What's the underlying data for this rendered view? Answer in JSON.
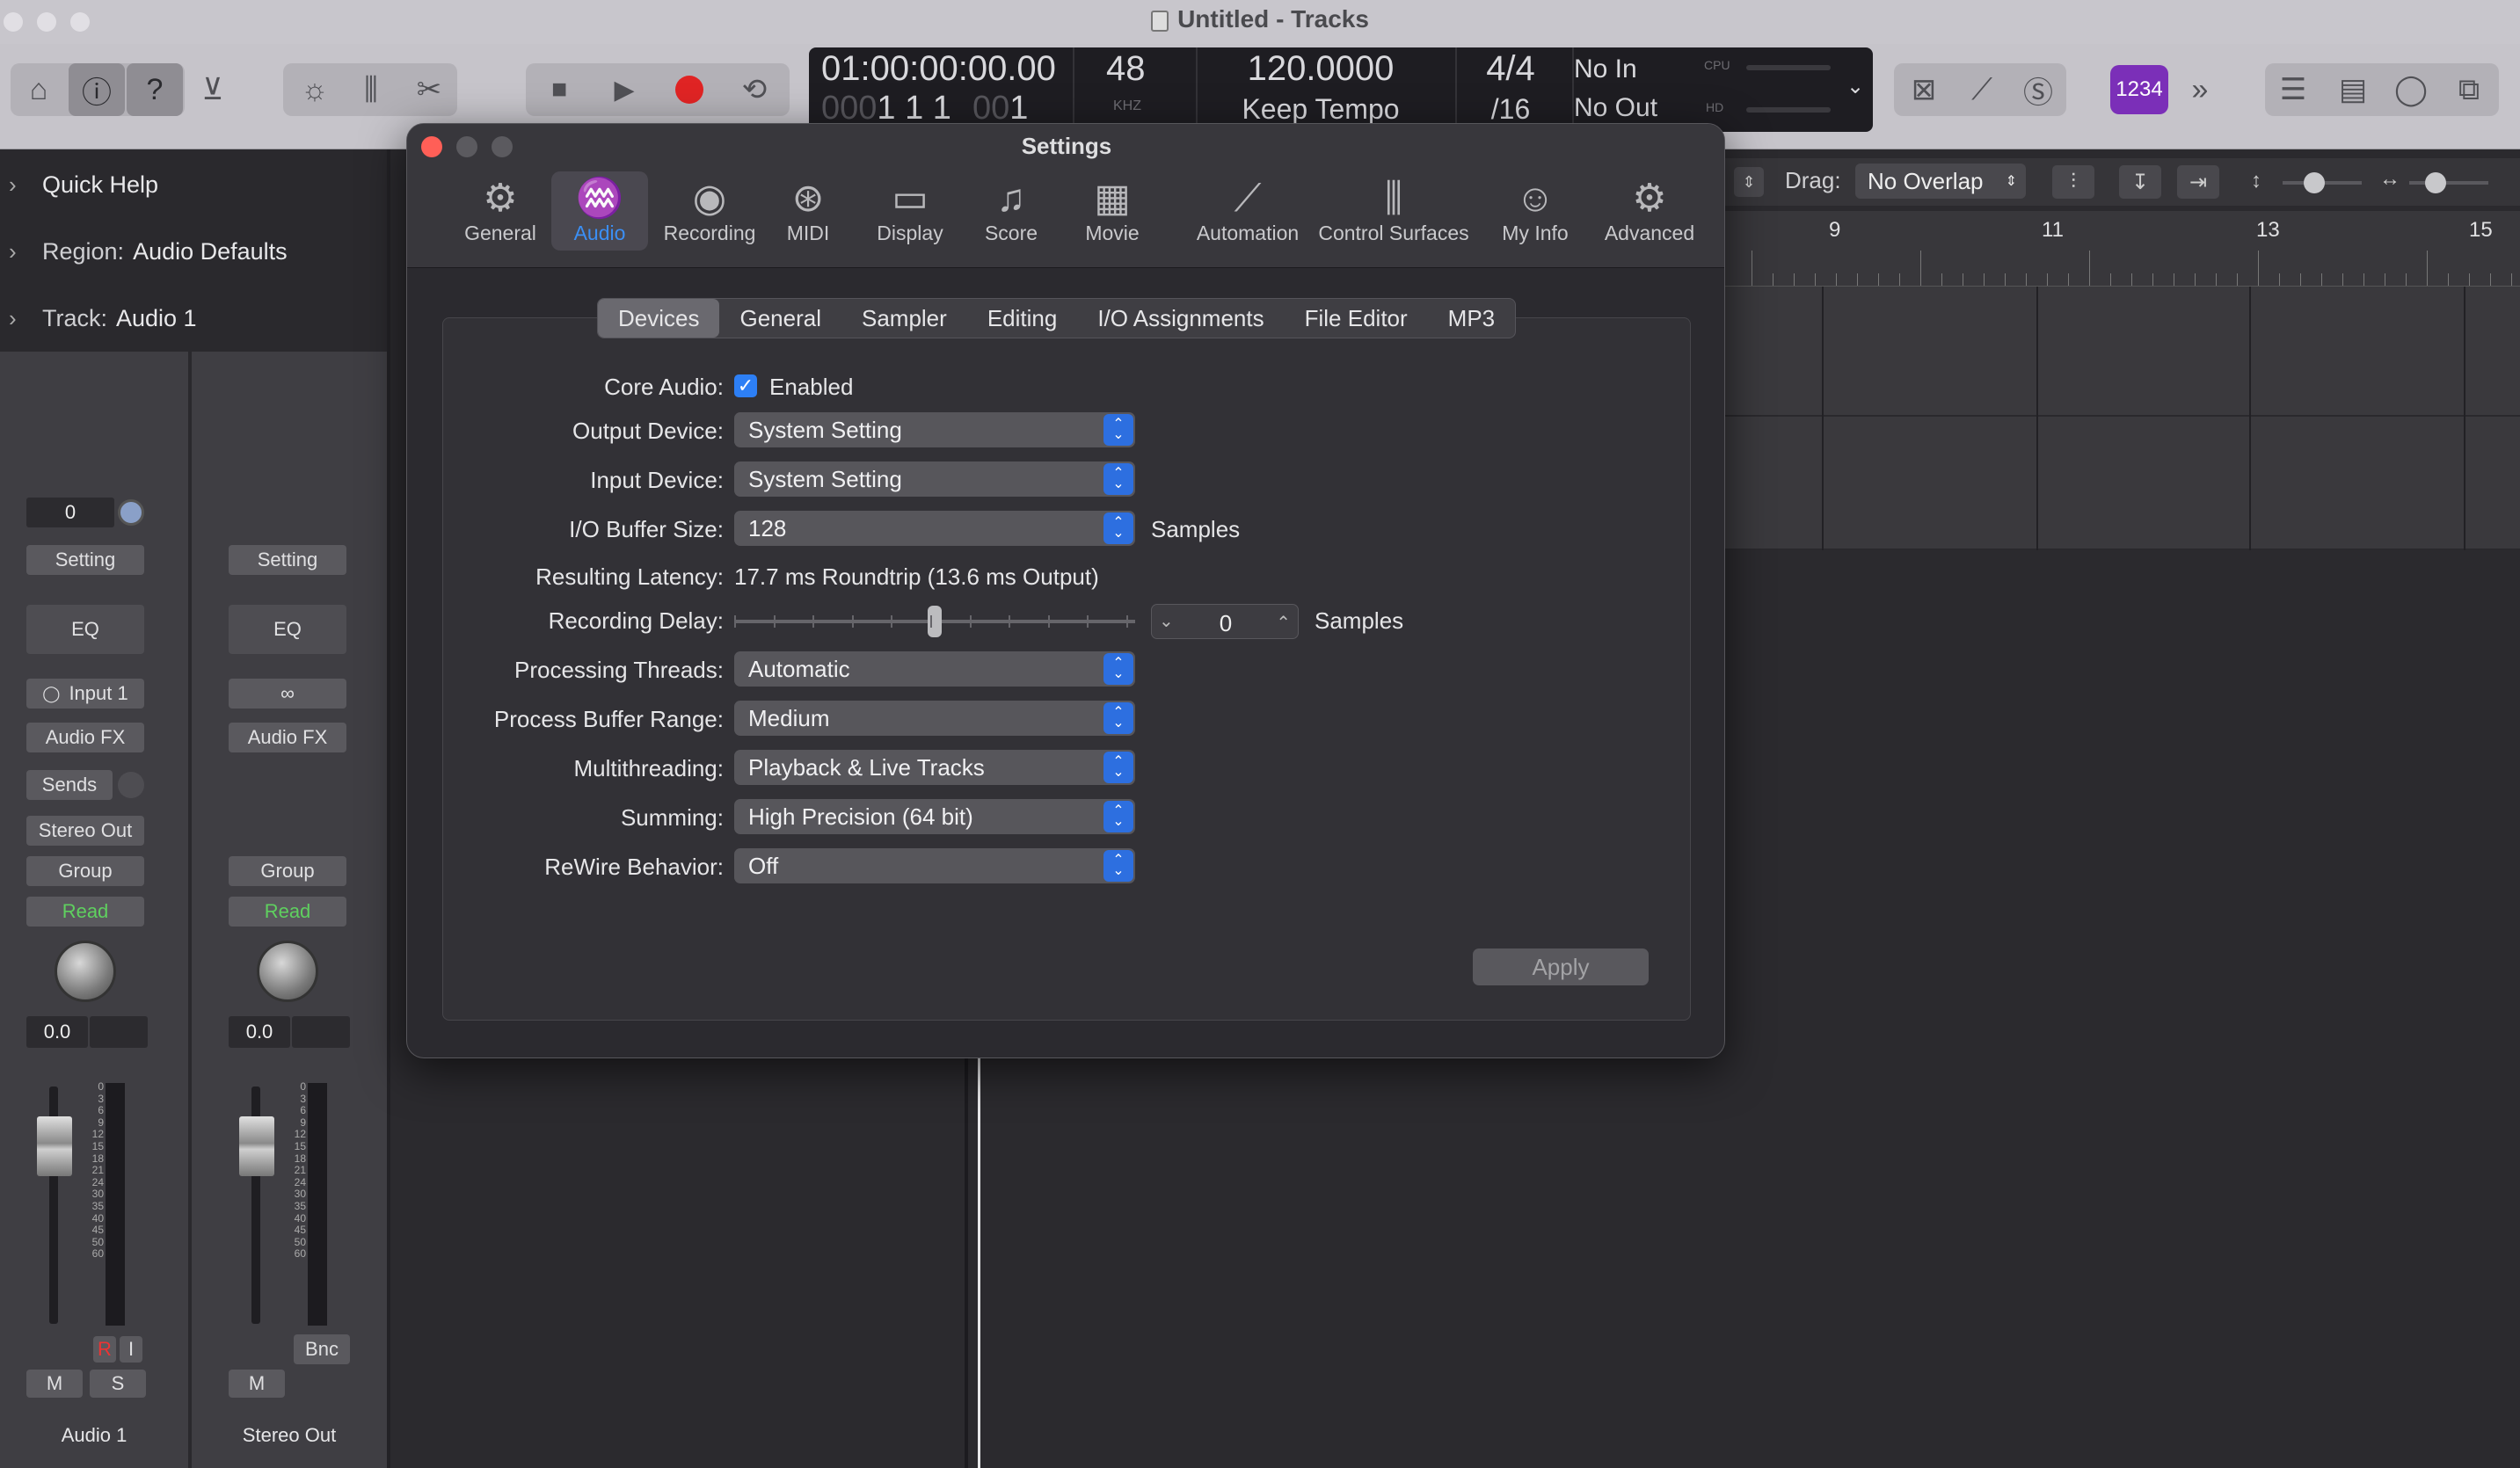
{
  "window": {
    "title": "Untitled - Tracks"
  },
  "lcd": {
    "time": "01:00:00:00.00",
    "bars_dim": "000",
    "bars": "1  1  1",
    "beat_dim": "00",
    "beat": "1",
    "samplerate": "48",
    "khz": "KHZ",
    "tempo": "120.0000",
    "tempo_mode": "Keep Tempo",
    "sig_top": "4/4",
    "sig_bottom": "/16",
    "in": "No In",
    "out": "No Out",
    "cpu": "CPU",
    "hd": "HD"
  },
  "toolbar": {
    "badge": "1234",
    "drag_label": "Drag:",
    "drag_value": "No Overlap"
  },
  "inspector": {
    "quick_help": "Quick Help",
    "region_label": "Region:",
    "region_value": "Audio Defaults",
    "track_label": "Track:",
    "track_value": "Audio 1"
  },
  "strip1": {
    "gain": "0",
    "setting": "Setting",
    "eq": "EQ",
    "input": "Input 1",
    "audiofx": "Audio FX",
    "sends": "Sends",
    "output": "Stereo Out",
    "group": "Group",
    "read": "Read",
    "vol": "0.0",
    "r": "R",
    "i": "I",
    "m": "M",
    "s": "S",
    "name": "Audio 1"
  },
  "strip2": {
    "setting": "Setting",
    "eq": "EQ",
    "audiofx": "Audio FX",
    "group": "Group",
    "read": "Read",
    "vol": "0.0",
    "bnc": "Bnc",
    "m": "M",
    "name": "Stereo Out"
  },
  "meter_scale": [
    "0",
    "3",
    "6",
    "9",
    "12",
    "15",
    "18",
    "21",
    "24",
    "30",
    "35",
    "40",
    "45",
    "50",
    "60"
  ],
  "ruler": {
    "marks": [
      "9",
      "11",
      "13",
      "15"
    ]
  },
  "settings": {
    "title": "Settings",
    "tabs": [
      "General",
      "Audio",
      "Recording",
      "MIDI",
      "Display",
      "Score",
      "Movie",
      "Automation",
      "Control Surfaces",
      "My Info",
      "Advanced"
    ],
    "subtabs": [
      "Devices",
      "General",
      "Sampler",
      "Editing",
      "I/O Assignments",
      "File Editor",
      "MP3"
    ],
    "core_audio_label": "Core Audio:",
    "core_audio_value": "Enabled",
    "output_device_label": "Output Device:",
    "output_device_value": "System Setting",
    "input_device_label": "Input Device:",
    "input_device_value": "System Setting",
    "buffer_label": "I/O Buffer Size:",
    "buffer_value": "128",
    "buffer_unit": "Samples",
    "latency_label": "Resulting Latency:",
    "latency_value": "17.7 ms Roundtrip (13.6 ms Output)",
    "delay_label": "Recording Delay:",
    "delay_value": "0",
    "delay_unit": "Samples",
    "delay_slider_fraction": 0.5,
    "threads_label": "Processing Threads:",
    "threads_value": "Automatic",
    "range_label": "Process Buffer Range:",
    "range_value": "Medium",
    "multithreading_label": "Multithreading:",
    "multithreading_value": "Playback & Live Tracks",
    "summing_label": "Summing:",
    "summing_value": "High Precision (64 bit)",
    "rewire_label": "ReWire Behavior:",
    "rewire_value": "Off",
    "apply": "Apply"
  }
}
